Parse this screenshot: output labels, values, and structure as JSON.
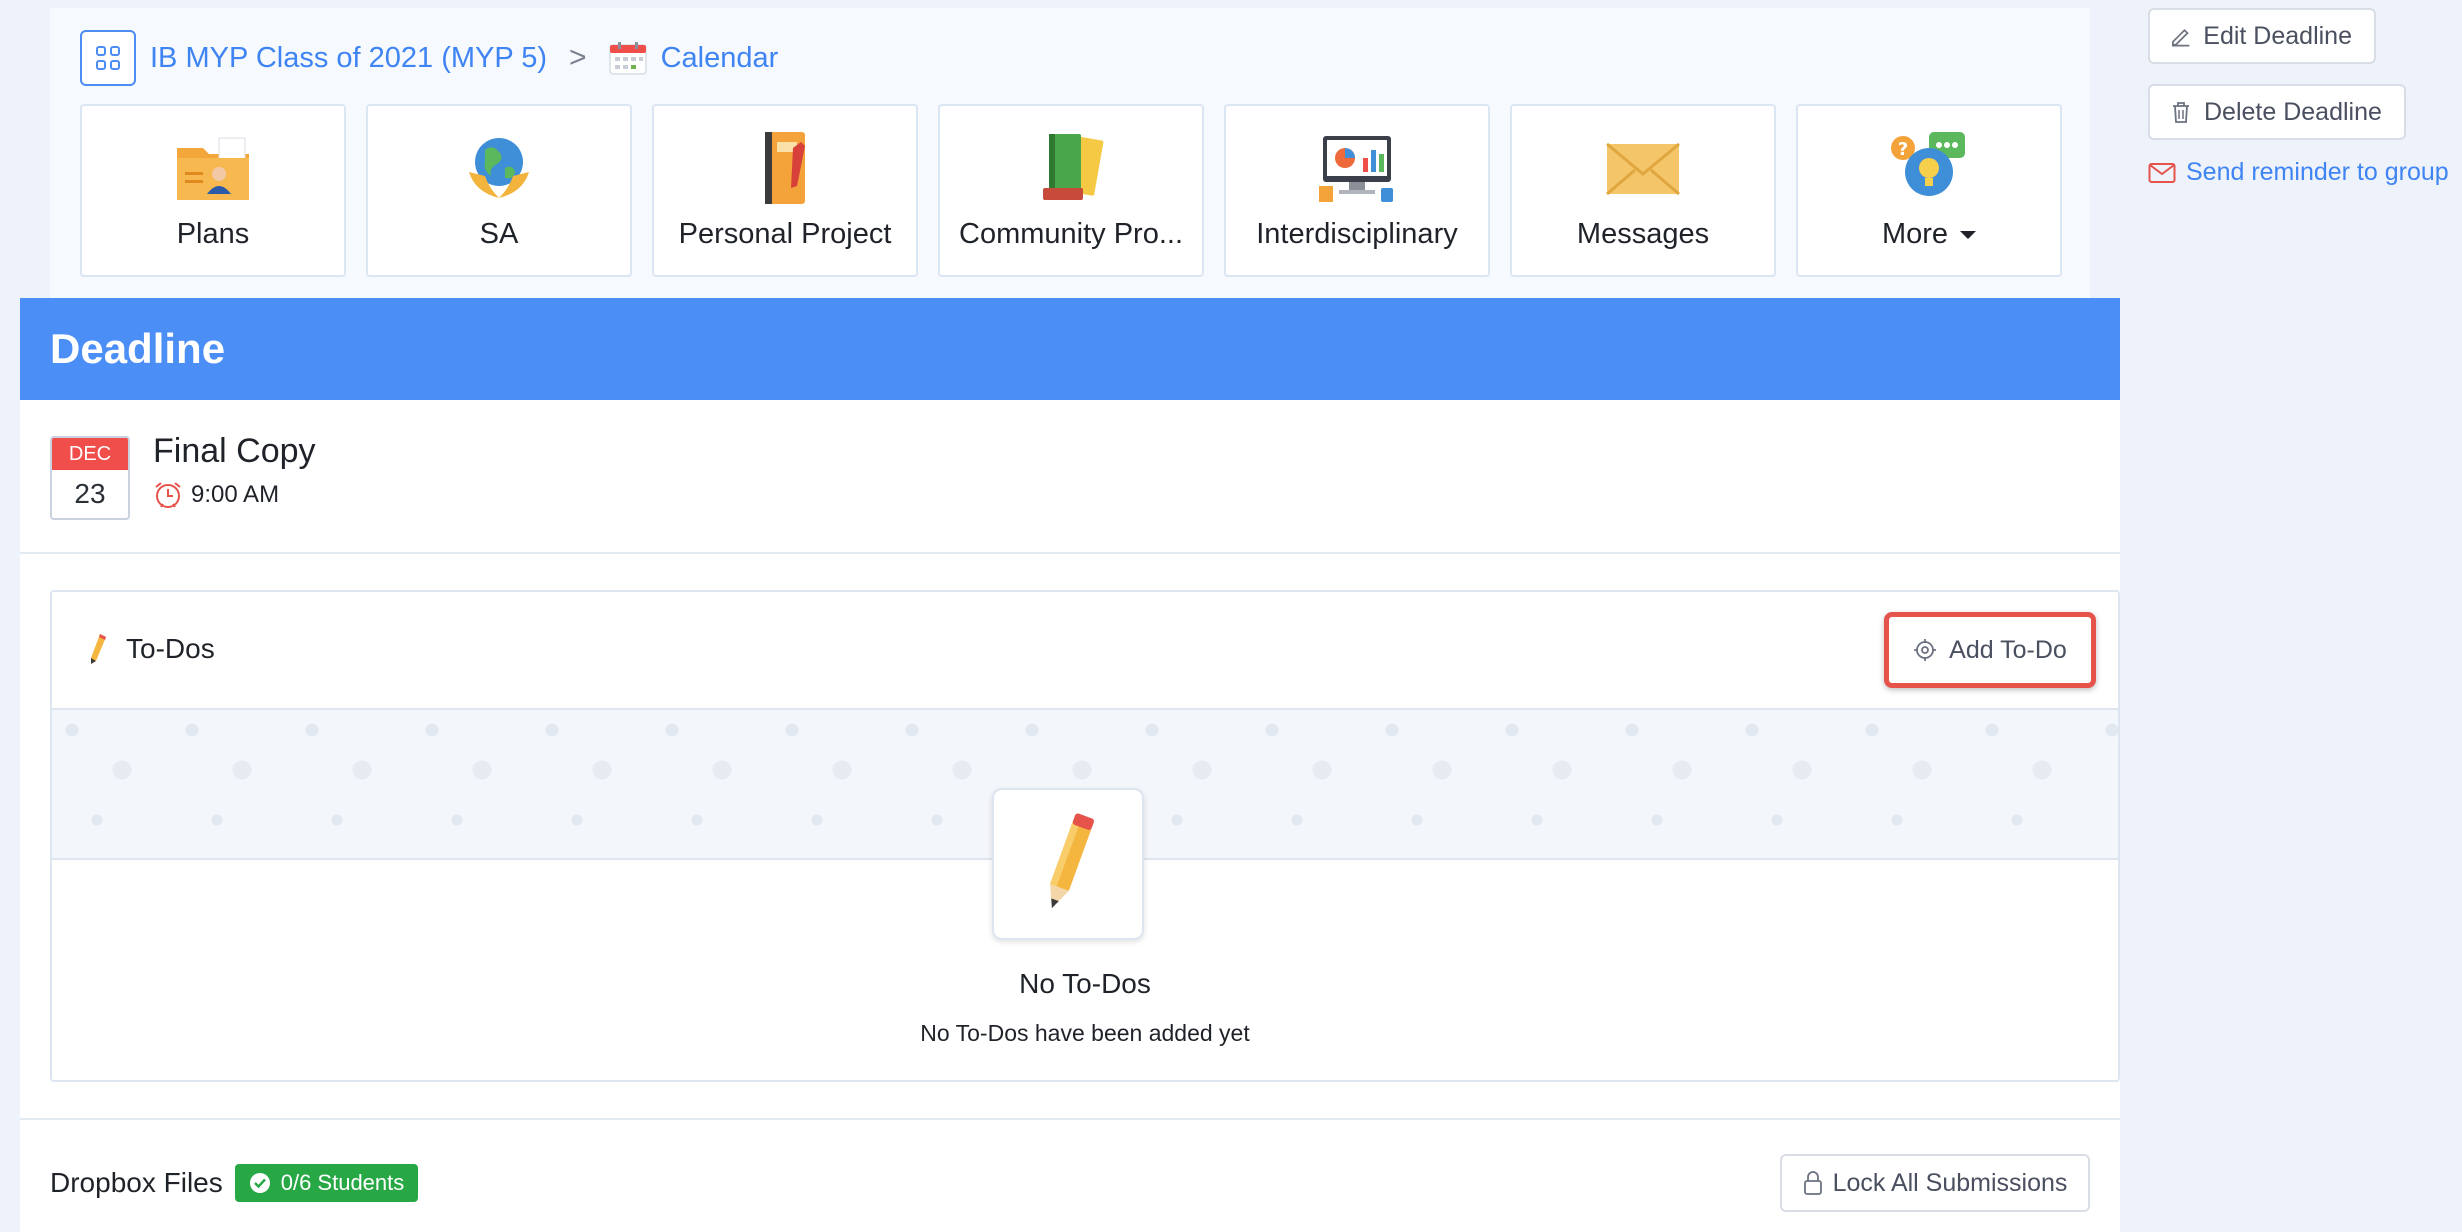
{
  "breadcrumb": {
    "class_name": "IB MYP Class of 2021 (MYP 5)",
    "separator": ">",
    "current": "Calendar"
  },
  "tiles": [
    {
      "label": "Plans",
      "icon": "plans-icon"
    },
    {
      "label": "SA",
      "icon": "globe-hands-icon"
    },
    {
      "label": "Personal Project",
      "icon": "notebook-icon"
    },
    {
      "label": "Community Pro...",
      "icon": "books-icon"
    },
    {
      "label": "Interdisciplinary",
      "icon": "computer-chart-icon"
    },
    {
      "label": "Messages",
      "icon": "envelope-icon"
    },
    {
      "label": "More",
      "icon": "help-chat-icon"
    }
  ],
  "actions": {
    "edit_label": "Edit Deadline",
    "delete_label": "Delete Deadline",
    "send_reminder_label": "Send reminder to group"
  },
  "deadline": {
    "header": "Deadline",
    "month": "DEC",
    "day": "23",
    "title": "Final Copy",
    "time": "9:00 AM"
  },
  "todos": {
    "title": "To-Dos",
    "add_label": "Add To-Do",
    "empty_title": "No To-Dos",
    "empty_subtitle": "No To-Dos have been added yet"
  },
  "dropbox": {
    "label": "Dropbox Files",
    "badge": "0/6 Students",
    "lock_label": "Lock All Submissions"
  },
  "colors": {
    "accent_blue": "#4b8ef6",
    "link_blue": "#3f84f3",
    "highlight_red": "#e5534b",
    "success_green": "#28a745",
    "date_red": "#ef4e4a"
  }
}
